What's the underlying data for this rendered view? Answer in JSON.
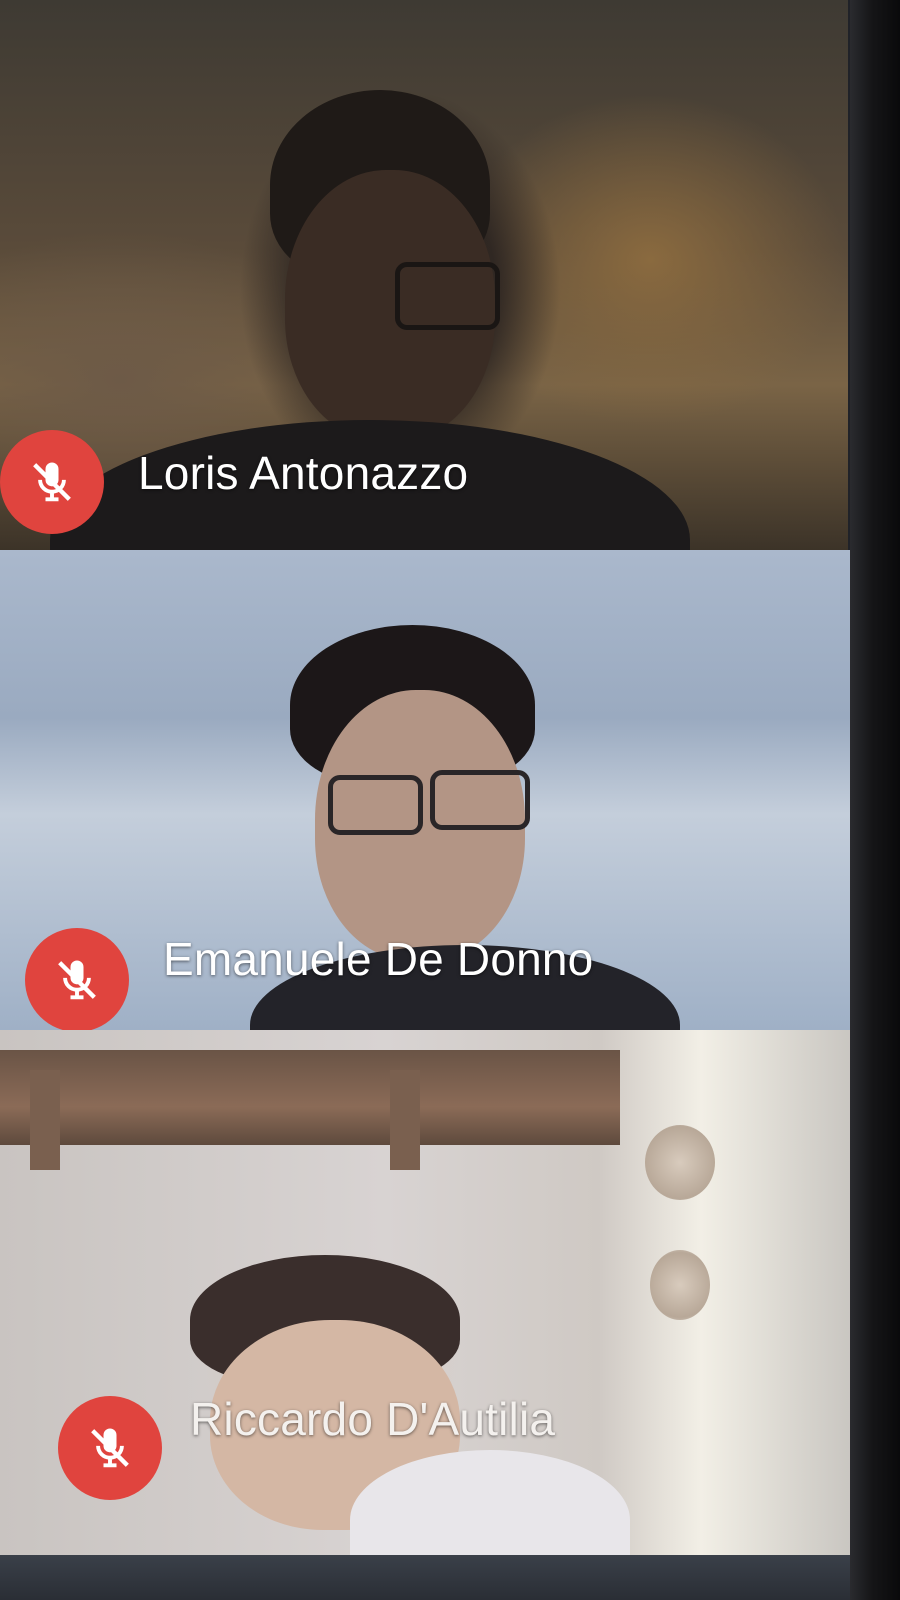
{
  "participants": [
    {
      "name": "Loris Antonazzo",
      "mic_status_icon": "mic-off-icon",
      "badge_color": "#e0443e"
    },
    {
      "name": "Emanuele De Donno",
      "mic_status_icon": "mic-off-icon",
      "badge_color": "#e0443e"
    },
    {
      "name": "Riccardo D'Autilia",
      "mic_status_icon": "mic-off-icon",
      "badge_color": "#e0443e"
    }
  ]
}
